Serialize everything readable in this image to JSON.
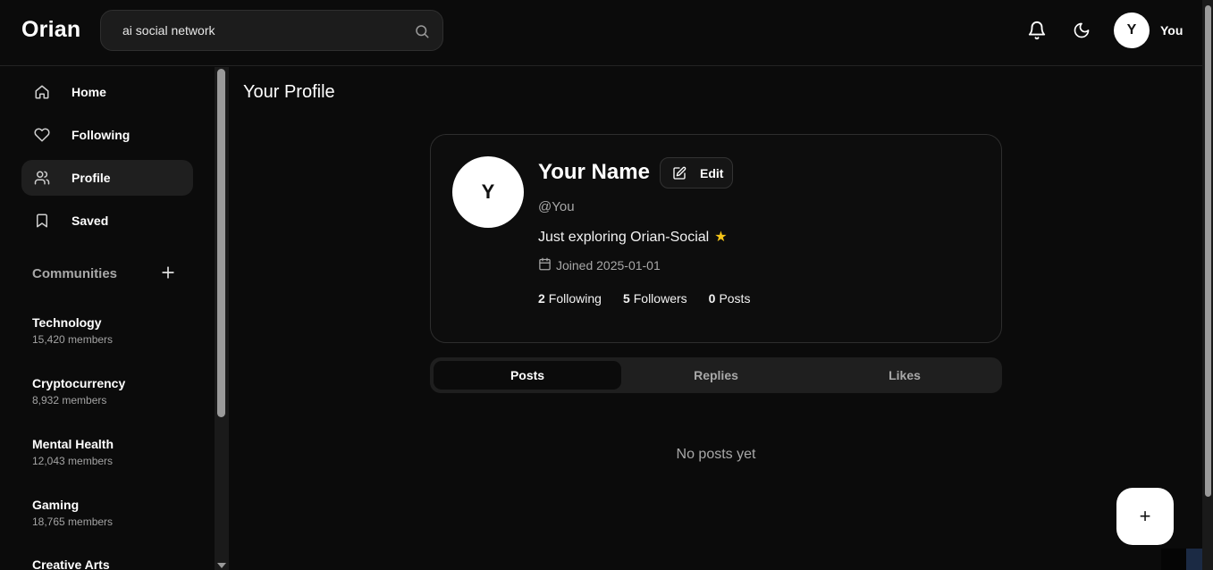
{
  "app": {
    "logo": "Orian"
  },
  "search": {
    "value": "ai social network",
    "placeholder": ""
  },
  "header": {
    "user_initial": "Y",
    "user_label": "You"
  },
  "sidebar": {
    "items": [
      {
        "label": "Home",
        "icon": "home-icon"
      },
      {
        "label": "Following",
        "icon": "heart-icon"
      },
      {
        "label": "Profile",
        "icon": "users-icon",
        "active": true
      },
      {
        "label": "Saved",
        "icon": "bookmark-icon"
      }
    ],
    "communities_title": "Communities",
    "communities": [
      {
        "name": "Technology",
        "members": "15,420 members"
      },
      {
        "name": "Cryptocurrency",
        "members": "8,932 members"
      },
      {
        "name": "Mental Health",
        "members": "12,043 members"
      },
      {
        "name": "Gaming",
        "members": "18,765 members"
      },
      {
        "name": "Creative Arts",
        "members": ""
      }
    ]
  },
  "main": {
    "title": "Your Profile",
    "profile": {
      "initial": "Y",
      "name": "Your Name",
      "edit_label": "Edit",
      "handle": "@You",
      "bio": "Just exploring Orian-Social",
      "bio_emoji": "★",
      "joined": "Joined 2025-01-01",
      "stats": [
        {
          "value": "2",
          "label": "Following"
        },
        {
          "value": "5",
          "label": "Followers"
        },
        {
          "value": "0",
          "label": "Posts"
        }
      ]
    },
    "tabs": [
      {
        "label": "Posts",
        "active": true
      },
      {
        "label": "Replies"
      },
      {
        "label": "Likes"
      }
    ],
    "empty_text": "No posts yet"
  },
  "fab": {
    "label": "+"
  },
  "colors": {
    "background": "#0b0b0b",
    "surface": "#1f1f1f",
    "star": "#f5c518",
    "accent": "#ffffff"
  }
}
